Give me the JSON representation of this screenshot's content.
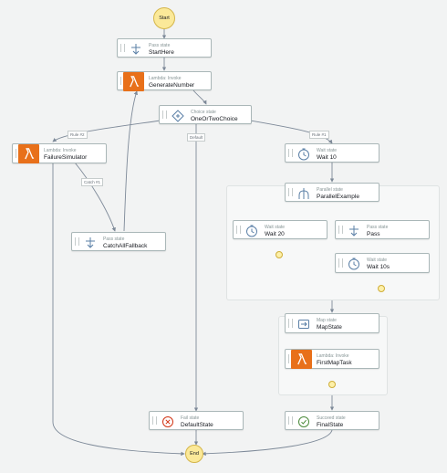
{
  "start": "Start",
  "end": "End",
  "nodes": {
    "start_here": {
      "type": "Pass state",
      "name": "StartHere",
      "icon": "pass-icon"
    },
    "generate_number": {
      "type": "Lambda: Invoke",
      "name": "GenerateNumber",
      "icon": "lambda-icon"
    },
    "choice": {
      "type": "Choice state",
      "name": "OneOrTwoChoice",
      "icon": "choice-icon"
    },
    "failure_simulator": {
      "type": "Lambda: Invoke",
      "name": "FailureSimulator",
      "icon": "lambda-icon"
    },
    "catch_all_fallback": {
      "type": "Pass state",
      "name": "CatchAllFallback",
      "icon": "pass-icon"
    },
    "wait_10": {
      "type": "Wait state",
      "name": "Wait 10",
      "icon": "clock-icon"
    },
    "parallel_example": {
      "type": "Parallel state",
      "name": "ParallelExample",
      "icon": "parallel-icon"
    },
    "wait_20": {
      "type": "Wait state",
      "name": "Wait 20",
      "icon": "clock-icon"
    },
    "pass": {
      "type": "Pass state",
      "name": "Pass",
      "icon": "pass-icon"
    },
    "wait_10s": {
      "type": "Wait state",
      "name": "Wait 10s",
      "icon": "clock-icon"
    },
    "map_state": {
      "type": "Map state",
      "name": "MapState",
      "icon": "map-icon"
    },
    "first_map_task": {
      "type": "Lambda: Invoke",
      "name": "FirstMapTask",
      "icon": "lambda-icon"
    },
    "default_state": {
      "type": "Fail state",
      "name": "DefaultState",
      "icon": "fail-icon"
    },
    "final_state": {
      "type": "Succeed state",
      "name": "FinalState",
      "icon": "succeed-icon"
    }
  },
  "edge_labels": {
    "rule2": "Rule #2",
    "default": "Default",
    "rule1": "Rule #1",
    "catch": "Catch #1"
  },
  "colors": {
    "lambda": "#e8701a",
    "start_end_fill": "#fbe999",
    "node_border": "#aab7b8",
    "edge": "#7d8998"
  }
}
